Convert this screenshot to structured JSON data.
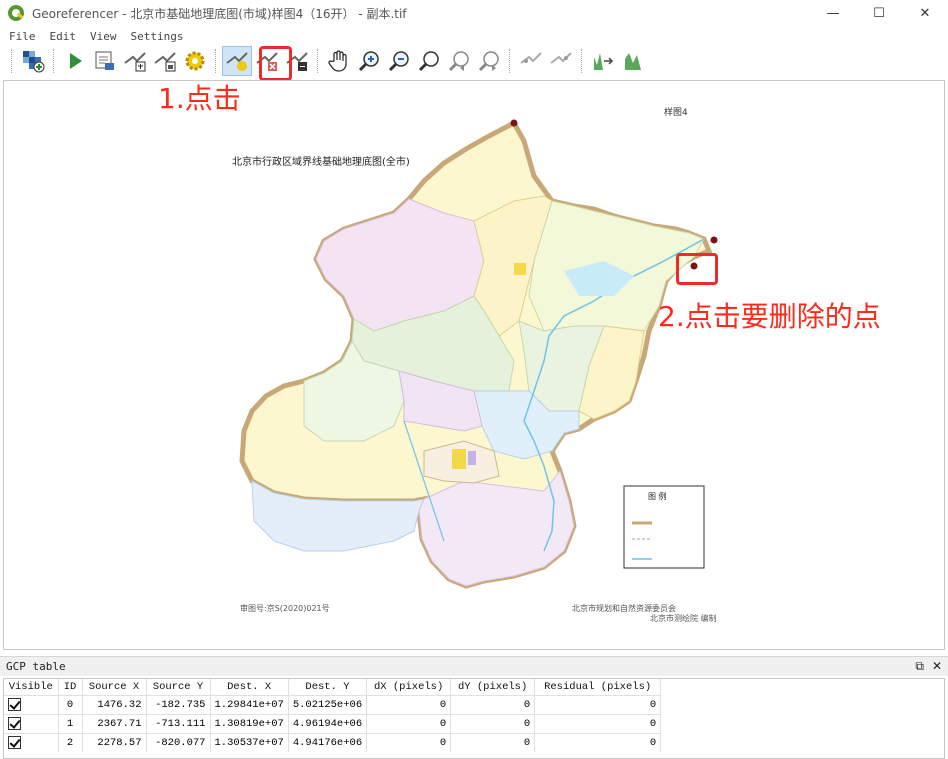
{
  "window": {
    "title": "Georeferencer - 北京市基础地理底图(市域)样图4（16开） - 副本.tif",
    "controls": [
      "—",
      "☐",
      "✕"
    ]
  },
  "menu": [
    "File",
    "Edit",
    "View",
    "Settings"
  ],
  "toolbar": {
    "buttons": [
      {
        "name": "open-raster-button",
        "icon": "open-raster-icon"
      },
      {
        "name": "start-georeferencing-button",
        "icon": "play-icon"
      },
      {
        "name": "generate-gdal-script-button",
        "icon": "script-icon"
      },
      {
        "name": "load-gcp-points-button",
        "icon": "load-gcp-icon"
      },
      {
        "name": "save-gcp-points-button",
        "icon": "save-gcp-icon"
      },
      {
        "name": "transformation-settings-button",
        "icon": "gear-icon"
      },
      {
        "name": "add-point-button",
        "icon": "add-point-icon"
      },
      {
        "name": "delete-point-button",
        "icon": "delete-point-icon"
      },
      {
        "name": "move-gcp-point-button",
        "icon": "move-point-icon"
      },
      {
        "name": "pan-button",
        "icon": "hand-icon"
      },
      {
        "name": "zoom-in-button",
        "icon": "zoom-in-icon"
      },
      {
        "name": "zoom-out-button",
        "icon": "zoom-out-icon"
      },
      {
        "name": "zoom-to-layer-button",
        "icon": "zoom-layer-icon"
      },
      {
        "name": "zoom-last-button",
        "icon": "zoom-last-icon"
      },
      {
        "name": "zoom-next-button",
        "icon": "zoom-next-icon"
      },
      {
        "name": "link-georeferencer-button",
        "icon": "link-geo-icon"
      },
      {
        "name": "link-qgis-button",
        "icon": "link-qgis-icon"
      },
      {
        "name": "full-histogram-stretch-button",
        "icon": "histogram-full-icon"
      },
      {
        "name": "local-histogram-stretch-button",
        "icon": "histogram-local-icon"
      }
    ]
  },
  "annotations": {
    "step1": "1.点击",
    "step2": "2.点击要删除的点"
  },
  "map": {
    "title": "北京市行政区域界线基础地理底图(全市)",
    "sheet_label": "样图4",
    "footer_left": "审图号:京S(2020)021号",
    "footer_right_1": "北京市规划和自然资源委员会",
    "footer_right_2": "北京市测绘院 编制",
    "legend_title": "图    例"
  },
  "gcp": {
    "title": "GCP table",
    "header_buttons": [
      "restore-icon",
      "close-icon"
    ],
    "columns": [
      "Visible",
      "ID",
      "Source X",
      "Source Y",
      "Dest. X",
      "Dest. Y",
      "dX (pixels)",
      "dY (pixels)",
      "Residual (pixels)"
    ],
    "rows": [
      {
        "visible": true,
        "id": "0",
        "source_x": "1476.32",
        "source_y": "-182.735",
        "dest_x": "1.29841e+07",
        "dest_y": "5.02125e+06",
        "dx": "0",
        "dy": "0",
        "residual": "0"
      },
      {
        "visible": true,
        "id": "1",
        "source_x": "2367.71",
        "source_y": "-713.111",
        "dest_x": "1.30819e+07",
        "dest_y": "4.96194e+06",
        "dx": "0",
        "dy": "0",
        "residual": "0"
      },
      {
        "visible": true,
        "id": "2",
        "source_x": "2278.57",
        "source_y": "-820.077",
        "dest_x": "1.30537e+07",
        "dest_y": "4.94176e+06",
        "dx": "0",
        "dy": "0",
        "residual": "0"
      }
    ]
  },
  "colors": {
    "highlight": "#ee2b2b",
    "annotation": "#ff2a1a",
    "gcp_point": "#7a1414"
  }
}
